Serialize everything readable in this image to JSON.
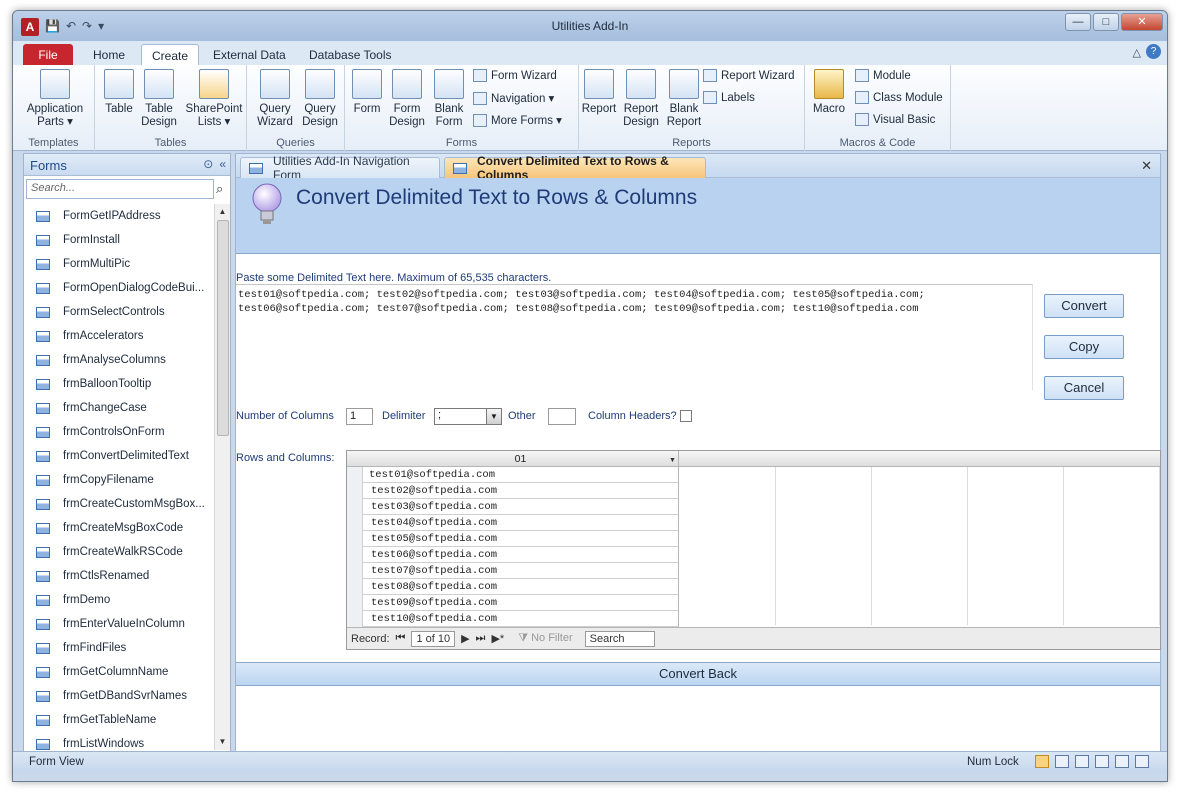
{
  "window": {
    "title": "Utilities Add-In",
    "app_icon": "A"
  },
  "ribbon_tabs": [
    "File",
    "Home",
    "Create",
    "External Data",
    "Database Tools"
  ],
  "ribbon": {
    "templates": {
      "label": "Templates",
      "application_parts": "Application Parts ▾"
    },
    "tables": {
      "label": "Tables",
      "table": "Table",
      "table_design": "Table Design",
      "sharepoint_lists": "SharePoint Lists ▾"
    },
    "queries": {
      "label": "Queries",
      "query_wizard": "Query Wizard",
      "query_design": "Query Design"
    },
    "forms": {
      "label": "Forms",
      "form": "Form",
      "form_design": "Form Design",
      "blank_form": "Blank Form",
      "form_wizard": "Form Wizard",
      "navigation": "Navigation ▾",
      "more_forms": "More Forms ▾"
    },
    "reports": {
      "label": "Reports",
      "report": "Report",
      "report_design": "Report Design",
      "blank_report": "Blank Report",
      "report_wizard": "Report Wizard",
      "labels": "Labels"
    },
    "macros": {
      "label": "Macros & Code",
      "macro": "Macro",
      "module": "Module",
      "class_module": "Class Module",
      "visual_basic": "Visual Basic"
    }
  },
  "nav": {
    "title": "Forms",
    "search_placeholder": "Search...",
    "items": [
      "FormGetIPAddress",
      "FormInstall",
      "FormMultiPic",
      "FormOpenDialogCodeBui...",
      "FormSelectControls",
      "frmAccelerators",
      "frmAnalyseColumns",
      "frmBalloonTooltip",
      "frmChangeCase",
      "frmControlsOnForm",
      "frmConvertDelimitedText",
      "frmCopyFilename",
      "frmCreateCustomMsgBox...",
      "frmCreateMsgBoxCode",
      "frmCreateWalkRSCode",
      "frmCtlsRenamed",
      "frmDemo",
      "frmEnterValueInColumn",
      "frmFindFiles",
      "frmGetColumnName",
      "frmGetDBandSvrNames",
      "frmGetTableName",
      "frmListWindows"
    ]
  },
  "doc_tabs": {
    "inactive": "Utilities Add-In Navigation Form",
    "active": "Convert Delimited Text to Rows & Columns"
  },
  "form": {
    "title": "Convert Delimited Text to Rows & Columns",
    "paste_label": "Paste some Delimited Text here.  Maximum of 65,535 characters.",
    "text_line1": "test01@softpedia.com; test02@softpedia.com; test03@softpedia.com; test04@softpedia.com; test05@softpedia.com;",
    "text_line2": "test06@softpedia.com; test07@softpedia.com; test08@softpedia.com; test09@softpedia.com; test10@softpedia.com",
    "convert": "Convert",
    "copy": "Copy",
    "cancel": "Cancel",
    "num_columns_label": "Number of Columns",
    "num_columns_value": "1",
    "delimiter_label": "Delimiter",
    "delimiter_value": ";",
    "other_label": "Other",
    "other_value": "",
    "column_headers_label": "Column Headers?",
    "rows_label": "Rows and Columns:",
    "grid_header": "01",
    "grid_rows": [
      "test01@softpedia.com",
      "test02@softpedia.com",
      "test03@softpedia.com",
      "test04@softpedia.com",
      "test05@softpedia.com",
      "test06@softpedia.com",
      "test07@softpedia.com",
      "test08@softpedia.com",
      "test09@softpedia.com",
      "test10@softpedia.com"
    ],
    "record_label": "Record:",
    "record_value": "1 of 10",
    "no_filter": "No Filter",
    "search": "Search",
    "convert_back": "Convert Back"
  },
  "status": {
    "view": "Form View",
    "num_lock": "Num Lock"
  }
}
